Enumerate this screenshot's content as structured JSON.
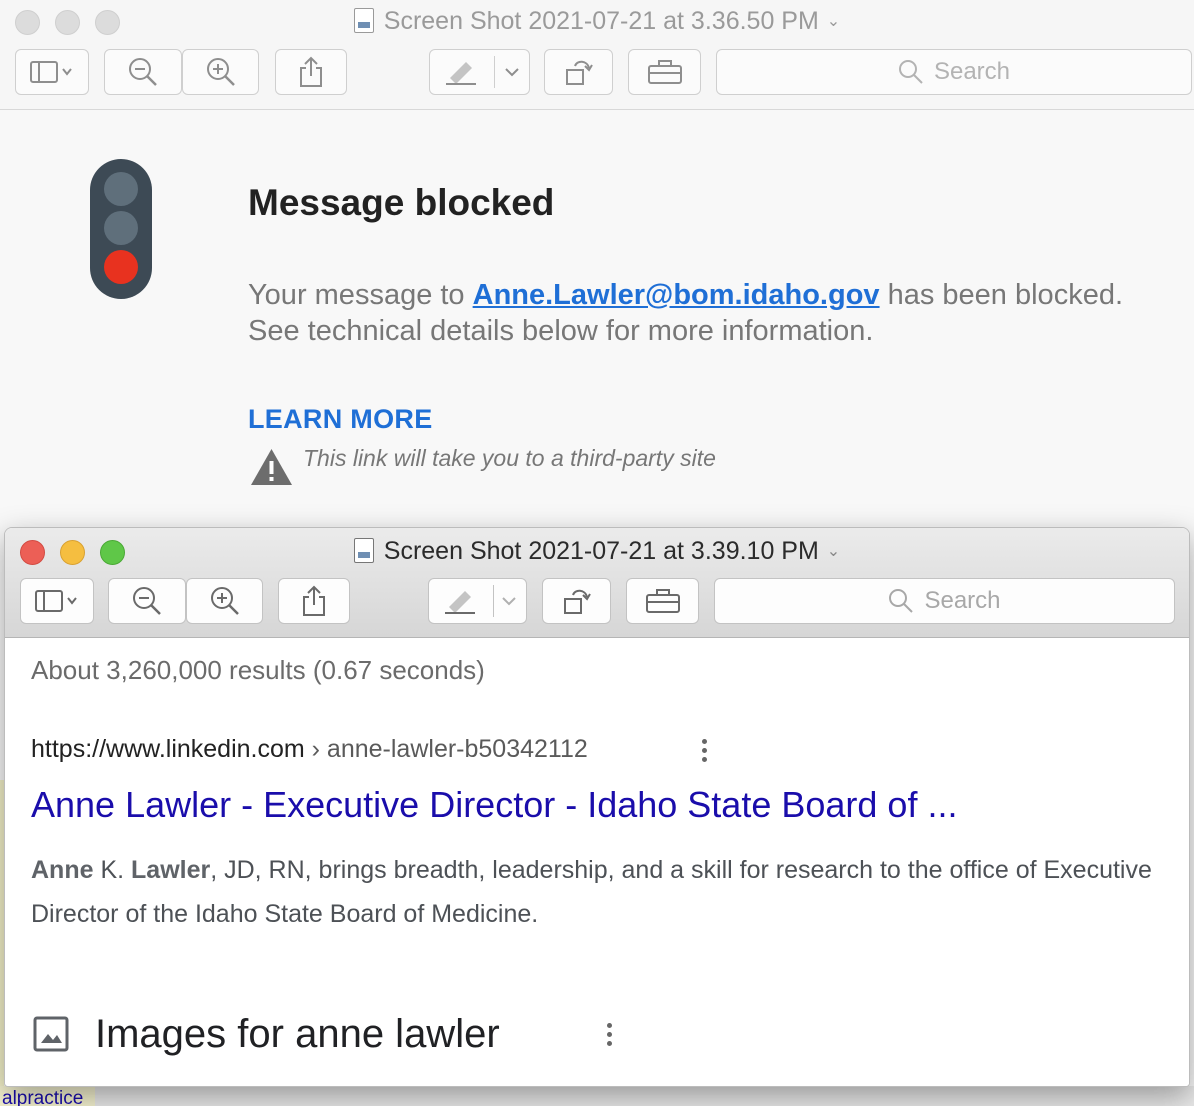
{
  "back_window": {
    "title": "Screen Shot 2021-07-21 at 3.36.50 PM",
    "search_placeholder": "Search",
    "message": {
      "title": "Message blocked",
      "body_prefix": "Your message to ",
      "email": "Anne.Lawler@bom.idaho.gov",
      "body_suffix": " has been blocked. See technical details below for more information.",
      "learn_more": "LEARN MORE",
      "warning": "This link will take you to a third-party site"
    }
  },
  "front_window": {
    "title": "Screen Shot 2021-07-21 at 3.39.10 PM",
    "search_placeholder": "Search",
    "results_count": "About 3,260,000 results (0.67 seconds)",
    "result": {
      "url_host": "https://www.linkedin.com",
      "url_path": " › anne-lawler-b50342112",
      "title": "Anne Lawler - Executive Director - Idaho State Board of ...",
      "snippet_bold1": "Anne",
      "snippet_mid1": " K. ",
      "snippet_bold2": "Lawler",
      "snippet_rest": ", JD, RN, brings breadth, leadership, and a skill for research to the office of Executive Director of the Idaho State Board of Medicine."
    },
    "images_heading": "Images for anne lawler"
  },
  "peek": {
    "bottom_left_text": "alpractice"
  },
  "colors": {
    "link_blue": "#1f6fd6",
    "result_title": "#1a0dab",
    "traffic_red": "#e8321f"
  },
  "icons": [
    "sidebar-toggle-icon",
    "zoom-out-icon",
    "zoom-in-icon",
    "share-icon",
    "markup-pen-icon",
    "rotate-icon",
    "toolbox-icon",
    "search-icon",
    "warning-icon",
    "traffic-light-icon",
    "image-icon",
    "more-vert-icon"
  ]
}
